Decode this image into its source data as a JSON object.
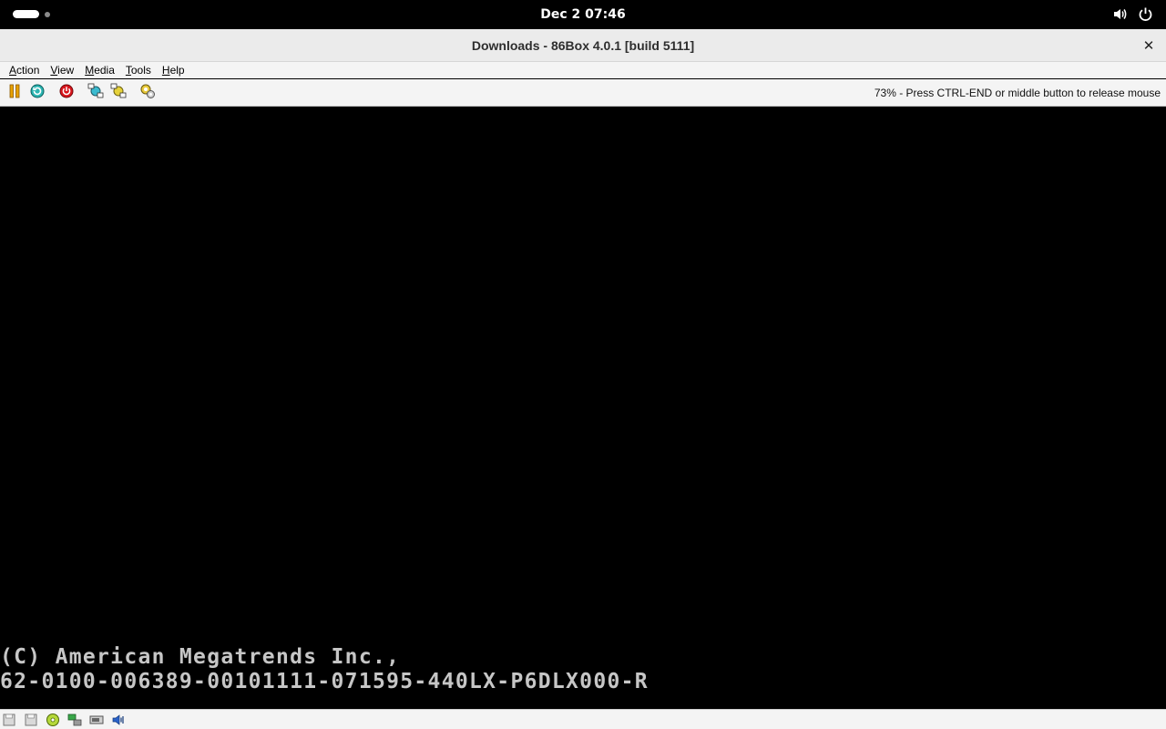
{
  "topbar": {
    "clock": "Dec 2  07:46",
    "icons": [
      "volume-icon",
      "power-icon"
    ]
  },
  "window": {
    "title": "Downloads - 86Box 4.0.1 [build 5111]",
    "close_label": "✕"
  },
  "menu": {
    "items": [
      {
        "label": "Action",
        "first": "A",
        "rest": "ction"
      },
      {
        "label": "View",
        "first": "V",
        "rest": "iew"
      },
      {
        "label": "Media",
        "first": "M",
        "rest": "edia"
      },
      {
        "label": "Tools",
        "first": "T",
        "rest": "ools"
      },
      {
        "label": "Help",
        "first": "H",
        "rest": "elp"
      }
    ]
  },
  "toolbar": {
    "buttons": [
      "pause-icon",
      "hard-reset-icon",
      "power-off-icon",
      "ctrl-alt-del-icon",
      "ctrl-alt-esc-icon",
      "settings-icon"
    ],
    "mouse_message": "73% - Press CTRL-END or middle button to release mouse"
  },
  "screen": {
    "line1": "(C) American Megatrends Inc.,",
    "line2": "62-0100-006389-00101111-071595-440LX-P6DLX000-R"
  },
  "statusbar": {
    "icons": [
      "floppy-a-icon",
      "floppy-b-icon",
      "cdrom-icon",
      "network-icon",
      "hard-disk-icon",
      "sound-icon"
    ]
  }
}
